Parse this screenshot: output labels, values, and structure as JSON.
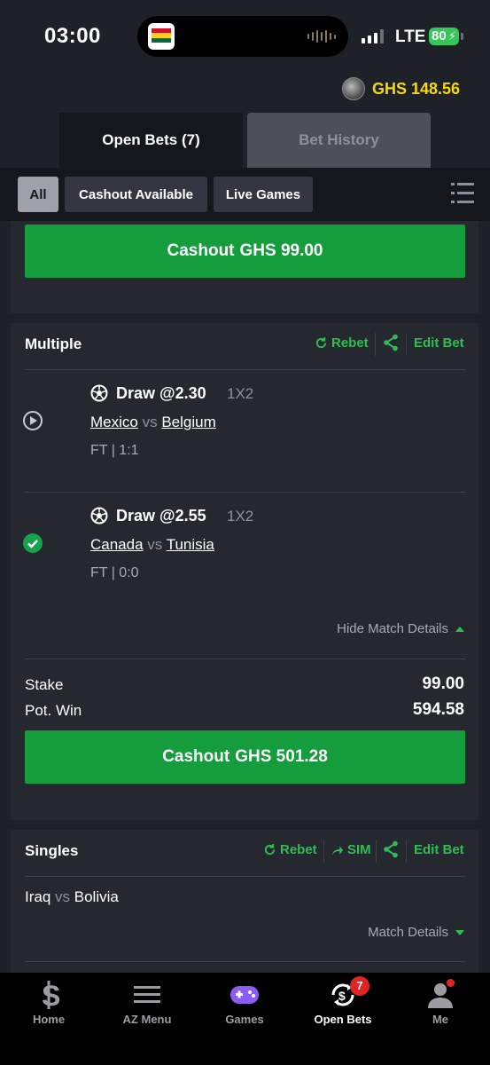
{
  "status_bar": {
    "time": "03:00",
    "network": "LTE",
    "battery": "80"
  },
  "balance": {
    "amount": "GHS 148.56"
  },
  "tabs": [
    {
      "label": "Open Bets (7)",
      "active": true
    },
    {
      "label": "Bet History",
      "active": false
    }
  ],
  "filters": [
    {
      "label": "All",
      "active": true
    },
    {
      "label": "Cashout Available",
      "active": false
    },
    {
      "label": "Live Games",
      "active": false
    }
  ],
  "top_card": {
    "cashout_label": "Cashout",
    "cashout_amount": "GHS 99.00"
  },
  "multiple": {
    "title": "Multiple",
    "rebet": "Rebet",
    "edit_bet": "Edit Bet",
    "legs": [
      {
        "status": "playing",
        "pick": "Draw @2.30",
        "market": "1X2",
        "home": "Mexico",
        "vs": "vs",
        "away": "Belgium",
        "score": "FT | 1:1"
      },
      {
        "status": "won",
        "pick": "Draw @2.55",
        "market": "1X2",
        "home": "Canada",
        "vs": "vs",
        "away": "Tunisia",
        "score": "FT | 0:0"
      }
    ],
    "hide_details": "Hide Match Details",
    "stake_label": "Stake",
    "stake_value": "99.00",
    "potwin_label": "Pot. Win",
    "potwin_value": "594.58",
    "cashout_label": "Cashout",
    "cashout_amount": "GHS 501.28"
  },
  "singles": {
    "title": "Singles",
    "rebet": "Rebet",
    "sim": "SIM",
    "edit_bet": "Edit Bet",
    "match": {
      "home": "Iraq",
      "vs": "vs",
      "away": "Bolivia"
    },
    "match_details": "Match Details"
  },
  "bottom_nav": [
    {
      "label": "Home",
      "icon": "home-s-icon"
    },
    {
      "label": "AZ Menu",
      "icon": "menu-icon"
    },
    {
      "label": "Games",
      "icon": "gamepad-icon"
    },
    {
      "label": "Open Bets",
      "icon": "open-bets-icon",
      "badge": "7",
      "active": true
    },
    {
      "label": "Me",
      "icon": "user-icon"
    }
  ],
  "colors": {
    "accent_green": "#159c3c",
    "link_green": "#2fbd55",
    "balance_yellow": "#f5d90a",
    "background": "#1f2129"
  }
}
